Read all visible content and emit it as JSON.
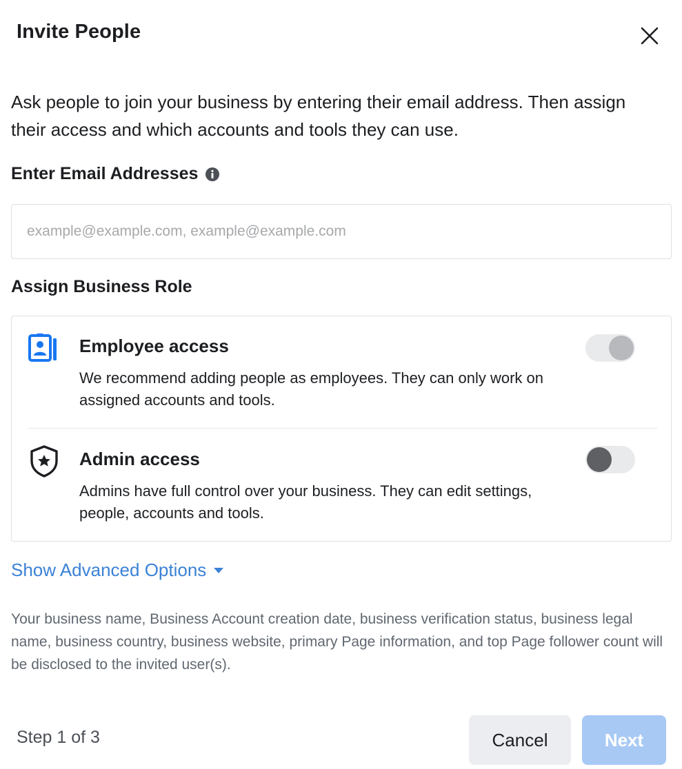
{
  "dialog": {
    "title": "Invite People",
    "close_icon": "close-icon",
    "intro": "Ask people to join your business by entering their email address. Then assign their access and which accounts and tools they can use."
  },
  "email": {
    "label": "Enter Email Addresses",
    "info_icon": "info-icon",
    "placeholder": "example@example.com, example@example.com",
    "value": ""
  },
  "role": {
    "label": "Assign Business Role",
    "options": [
      {
        "title": "Employee access",
        "description": "We recommend adding people as employees. They can only work on assigned accounts and tools.",
        "icon": "employee-badge-icon",
        "toggle_state": "on",
        "toggle_disabled": true
      },
      {
        "title": "Admin access",
        "description": "Admins have full control over your business. They can edit settings, people, accounts and tools.",
        "icon": "admin-shield-icon",
        "toggle_state": "off",
        "toggle_disabled": false
      }
    ]
  },
  "advanced": {
    "label": "Show Advanced Options",
    "icon": "caret-down-icon"
  },
  "disclosure": "Your business name, Business Account creation date, business verification status, business legal name, business country, business website, primary Page information, and top Page follower count will be disclosed to the invited user(s).",
  "footer": {
    "step": "Step 1 of 3",
    "cancel_label": "Cancel",
    "next_label": "Next"
  },
  "colors": {
    "accent": "#1877f2",
    "link": "#3b82d6",
    "next_disabled": "#a9c9f5"
  }
}
